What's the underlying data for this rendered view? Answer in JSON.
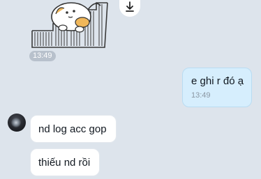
{
  "conversation": {
    "sticker": {
      "icon": "cat-sticker-icon",
      "time": "13:49",
      "download_icon": "download-icon"
    },
    "outgoing": [
      {
        "text": "e ghi r đó ạ",
        "time": "13:49"
      }
    ],
    "incoming": [
      {
        "text": "nd log acc gop"
      },
      {
        "text": "thiếu nd rồi"
      }
    ]
  },
  "colors": {
    "background": "#dde4ec",
    "outgoing_bubble": "#d6eefd",
    "incoming_bubble": "#ffffff",
    "time_pill": "#b8c1cc"
  }
}
